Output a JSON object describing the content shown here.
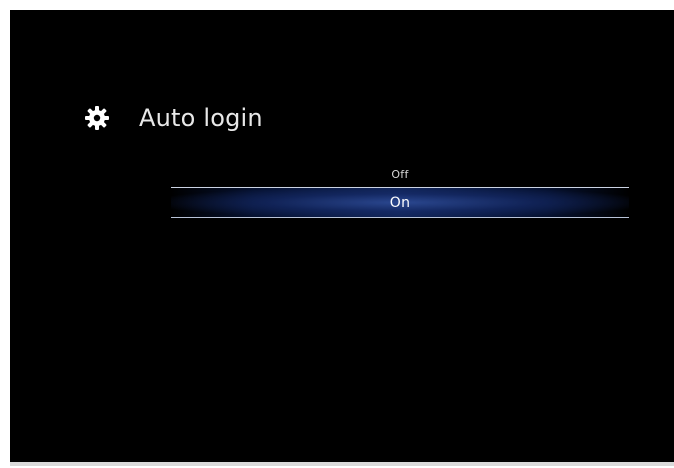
{
  "screen": {
    "title": "Auto login",
    "icon": "gear-icon"
  },
  "options": [
    {
      "label": "Off",
      "selected": false
    },
    {
      "label": "On",
      "selected": true
    }
  ],
  "colors": {
    "background": "#000000",
    "text": "#e8e8e8",
    "selection": "#162f7a",
    "frame_border": "#d9d9d9"
  }
}
